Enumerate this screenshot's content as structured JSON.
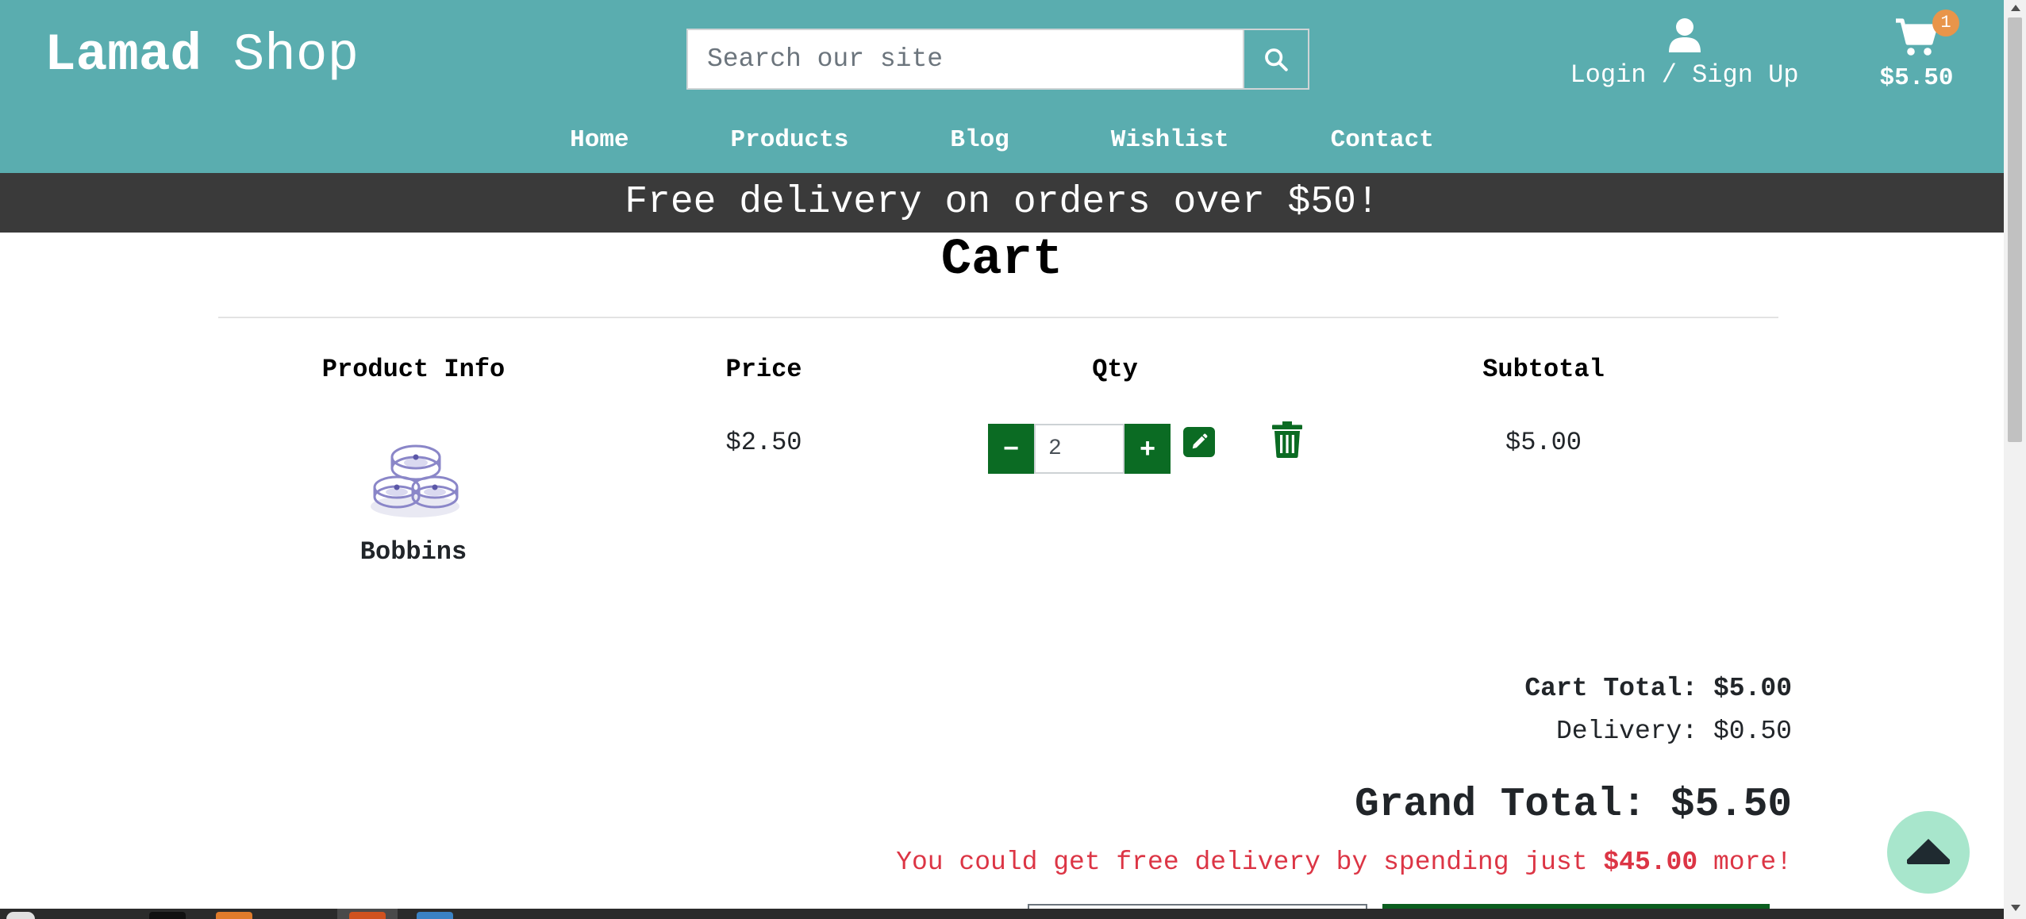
{
  "header": {
    "logo_bold": "Lamad",
    "logo_light": "Shop",
    "search_placeholder": "Search our site",
    "search_icon": "search-icon",
    "account_icon": "user-icon",
    "account_label": "Login / Sign Up",
    "cart_icon": "shopping-cart-icon",
    "cart_badge": "1",
    "cart_total": "$5.50",
    "background_color": "#5aadaf"
  },
  "nav": {
    "items": [
      "Home",
      "Products",
      "Blog",
      "Wishlist",
      "Contact"
    ]
  },
  "promo_banner": "Free delivery on orders over $50!",
  "page_title": "Cart",
  "table": {
    "headers": [
      "Product Info",
      "Price",
      "Qty",
      "Subtotal"
    ],
    "rows": [
      {
        "product_name": "Bobbins",
        "price": "$2.50",
        "qty": "2",
        "subtotal": "$5.00"
      }
    ],
    "qty_minus": "−",
    "qty_plus": "+",
    "edit_icon": "pencil-icon",
    "delete_icon": "trash-icon"
  },
  "summary": {
    "cart_total": "Cart Total: $5.00",
    "delivery": "Delivery: $0.50",
    "grand_total": "Grand Total: $5.50",
    "free_delivery_prefix": "You could get free delivery by spending just ",
    "free_delivery_amount": "$45.00",
    "free_delivery_suffix": " more!"
  },
  "colors": {
    "accent_green": "#0b6b23",
    "promo_dark": "#3a3a3a",
    "warning_red": "#dc3545",
    "scroll_top_mint": "#a8e6cc"
  },
  "scroll_top_icon": "chevron-up-icon"
}
